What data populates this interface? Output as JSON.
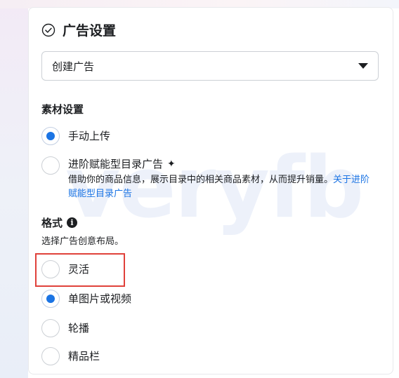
{
  "header": {
    "title": "广告设置",
    "icon": "check-circle-icon"
  },
  "campaign_select": {
    "value": "创建广告"
  },
  "creative_setup": {
    "title": "素材设置",
    "options": [
      {
        "label": "手动上传",
        "checked": true
      },
      {
        "label": "进阶赋能型目录广告",
        "sparkle": "✦",
        "description": "借助你的商品信息，展示目录中的相关商品素材，从而提升销量。",
        "link": "关于进阶赋能型目录广告",
        "checked": false
      }
    ]
  },
  "format": {
    "title": "格式",
    "info": "i",
    "description": "选择广告创意布局。",
    "options": [
      {
        "label": "灵活",
        "checked": false
      },
      {
        "label": "单图片或视频",
        "checked": true
      },
      {
        "label": "轮播",
        "checked": false
      },
      {
        "label": "精品栏",
        "checked": false
      }
    ]
  },
  "watermark": "veryfb",
  "colors": {
    "accent": "#1b74e4",
    "highlight_border": "#e0413b",
    "text": "#1c1e21"
  }
}
